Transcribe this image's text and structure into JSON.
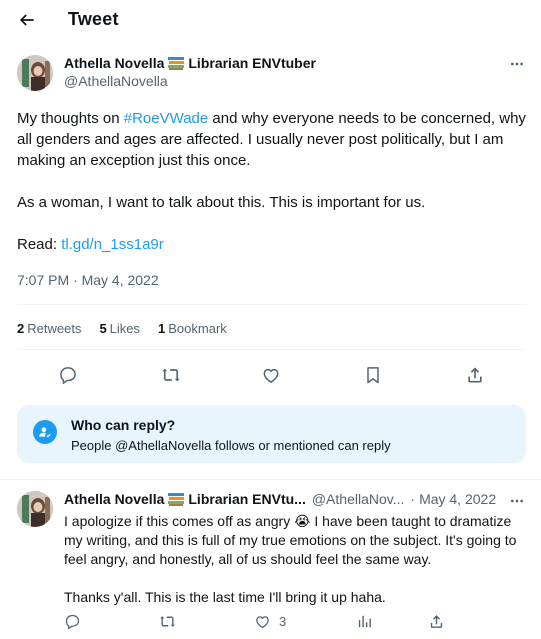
{
  "header": {
    "title": "Tweet"
  },
  "tweet": {
    "author": {
      "display_name": "Athella Novella",
      "name_suffix": "Librarian ENVtuber",
      "handle": "@AthellaNovella"
    },
    "text": {
      "line1_prefix": "My thoughts on ",
      "hashtag": "#RoeVWade",
      "line1_suffix": " and why everyone needs to be concerned, why all genders and ages are affected. I usually never post politically, but I am making an exception just this once.",
      "paragraph2": "As a woman, I want to talk about this. This is important for us.",
      "read_label": "Read: ",
      "link": "tl.gd/n_1ss1a9r"
    },
    "timestamp": "7:07 PM · May 4, 2022",
    "stats": {
      "retweets_count": "2",
      "retweets_label": "Retweets",
      "likes_count": "5",
      "likes_label": "Likes",
      "bookmarks_count": "1",
      "bookmarks_label": "Bookmark"
    }
  },
  "who_can_reply": {
    "title": "Who can reply?",
    "subtitle": "People @AthellaNovella follows or mentioned can reply"
  },
  "reply": {
    "display_name": "Athella Novella",
    "name_suffix": "Librarian ENVtu...",
    "handle": "@AthellaNov...",
    "date": "May 4, 2022",
    "separator": "·",
    "text_line1": "I apologize if this comes off as angry 😭 I have been taught to dramatize my writing, and this is full of my true emotions on the subject. It's going to feel angry, and honestly, all of us should feel the same way.",
    "text_line2": "Thanks y'all. This is the last time I'll bring it up haha.",
    "likes_count": "3"
  },
  "colors": {
    "accent": "#1d9bf0",
    "text_primary": "#0f1419",
    "text_secondary": "#536471",
    "divider": "#eff3f4",
    "reply_box_bg": "#e8f5fd"
  },
  "icons": [
    "arrow-left-icon",
    "more-icon",
    "books-icon",
    "reply-icon",
    "retweet-icon",
    "like-icon",
    "bookmark-icon",
    "share-icon",
    "analytics-icon",
    "person-check-icon",
    "crying-emoji-icon"
  ]
}
